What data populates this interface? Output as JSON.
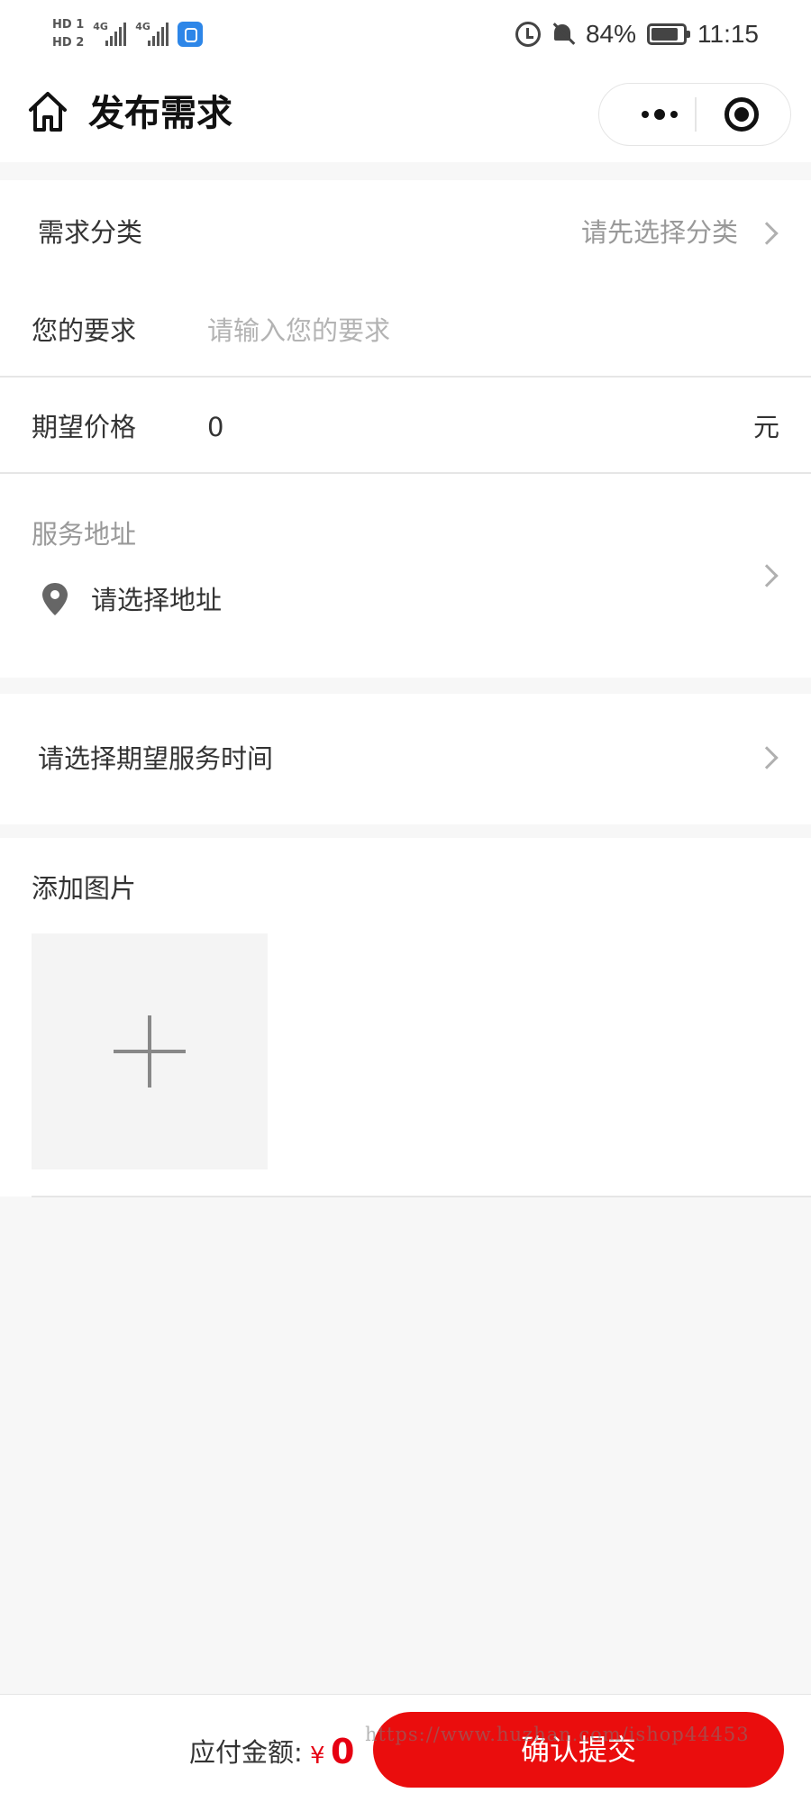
{
  "status_bar": {
    "hd1": "HD 1",
    "hd2": "HD 2",
    "net1": "4G",
    "net2": "4G",
    "battery_percent": "84%",
    "battery_level": 0.84,
    "time": "11:15"
  },
  "nav": {
    "title": "发布需求",
    "home_icon": "home-icon",
    "more_icon": "more-dots-icon",
    "close_icon": "target-circle-icon"
  },
  "form": {
    "category": {
      "label": "需求分类",
      "hint": "请先选择分类"
    },
    "requirement": {
      "label": "您的要求",
      "placeholder": "请输入您的要求"
    },
    "price": {
      "label": "期望价格",
      "value": "0",
      "unit": "元"
    },
    "address": {
      "section_label": "服务地址",
      "placeholder": "请选择地址",
      "icon": "location-pin-icon"
    },
    "service_time": {
      "label": "请选择期望服务时间"
    },
    "images": {
      "label": "添加图片",
      "add_icon": "plus-icon"
    }
  },
  "bottom": {
    "pay_label": "应付金额:",
    "currency": "¥",
    "amount": "0",
    "submit_label": "确认提交",
    "watermark": "https://www.huzhan.com/ishop44453"
  },
  "colors": {
    "accent": "#ea0d0d",
    "amount": "#e60012",
    "page_bg": "#f7f7f7"
  }
}
